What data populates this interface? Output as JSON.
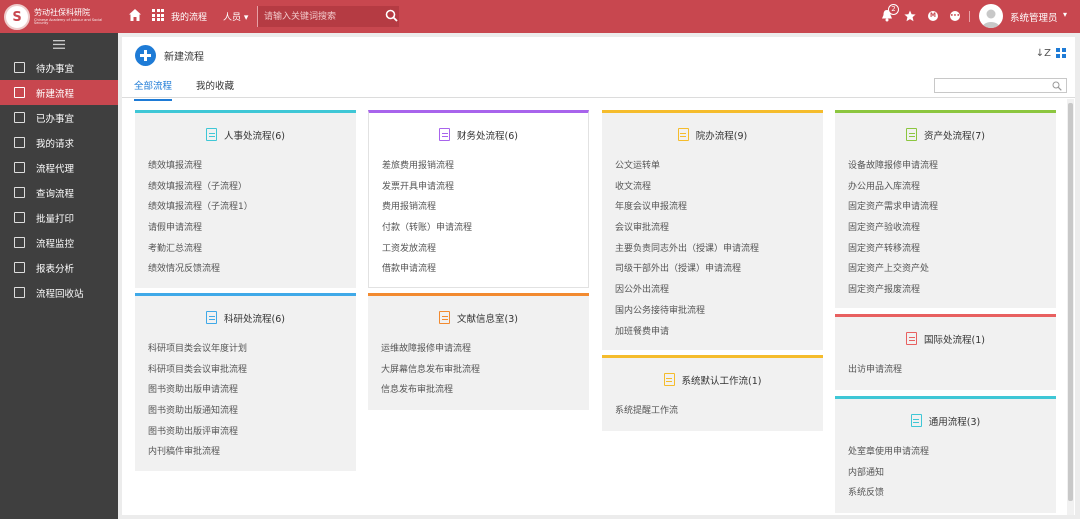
{
  "header": {
    "logo_cn": "劳动社保科研院",
    "logo_en": "Chinese Academy of Labour and Social Security",
    "logo_mark": "S",
    "nav_flow": "我的流程",
    "search_category": "人员",
    "search_placeholder": "请输入关键词搜索",
    "notification_count": "2",
    "round_icon_m": "M",
    "round_icon_more": "•••",
    "user_name": "系统管理员",
    "accent_color": "#c8474f"
  },
  "sidebar": {
    "items": [
      {
        "label": "待办事宜",
        "icon": "todo-icon"
      },
      {
        "label": "新建流程",
        "icon": "new-flow-icon",
        "active": true
      },
      {
        "label": "已办事宜",
        "icon": "done-icon"
      },
      {
        "label": "我的请求",
        "icon": "request-icon"
      },
      {
        "label": "流程代理",
        "icon": "agent-icon"
      },
      {
        "label": "查询流程",
        "icon": "search-icon"
      },
      {
        "label": "批量打印",
        "icon": "print-icon"
      },
      {
        "label": "流程监控",
        "icon": "monitor-icon"
      },
      {
        "label": "报表分析",
        "icon": "report-icon"
      },
      {
        "label": "流程回收站",
        "icon": "recycle-icon"
      }
    ]
  },
  "main": {
    "title": "新建流程",
    "sort_label": "↓Z",
    "tabs": [
      {
        "label": "全部流程",
        "active": true
      },
      {
        "label": "我的收藏"
      }
    ],
    "filter_placeholder": ""
  },
  "cards": [
    {
      "name": "card-hr",
      "title": "人事处流程(6)",
      "color": "#3fc7d6",
      "items": [
        "绩效填报流程",
        "绩效填报流程（子流程）",
        "绩效填报流程（子流程1）",
        "请假申请流程",
        "考勤汇总流程",
        "绩效情况反馈流程"
      ]
    },
    {
      "name": "card-research",
      "title": "科研处流程(6)",
      "color": "#3fa9e8",
      "items": [
        "科研项目类会议年度计划",
        "科研项目类会议审批流程",
        "图书资助出版申请流程",
        "图书资助出版通知流程",
        "图书资助出版评审流程",
        "内刊稿件审批流程"
      ]
    },
    {
      "name": "card-finance",
      "title": "财务处流程(6)",
      "color": "#a864ec",
      "items": [
        "差旅费用报销流程",
        "发票开具申请流程",
        "费用报销流程",
        "付款（转账）申请流程",
        "工资发放流程",
        "借款申请流程"
      ]
    },
    {
      "name": "card-literature",
      "title": "文献信息室(3)",
      "color": "#f28a30",
      "items": [
        "运维故障报修申请流程",
        "大屏幕信息发布审批流程",
        "信息发布审批流程"
      ]
    },
    {
      "name": "card-office",
      "title": "院办流程(9)",
      "color": "#f5bc2c",
      "items": [
        "公文运转单",
        "收文流程",
        "年度会议申报流程",
        "会议审批流程",
        "主要负责同志外出（授课）申请流程",
        "司级干部外出（授课）申请流程",
        "因公外出流程",
        "国内公务接待审批流程",
        "加班餐费申请"
      ]
    },
    {
      "name": "card-default",
      "title": "系统默认工作流(1)",
      "color": "#f5bc2c",
      "items": [
        "系统提醒工作流"
      ]
    },
    {
      "name": "card-assets",
      "title": "资产处流程(7)",
      "color": "#8cc63f",
      "items": [
        "设备故障报修申请流程",
        "办公用品入库流程",
        "固定资产需求申请流程",
        "固定资产验收流程",
        "固定资产转移流程",
        "固定资产上交资产处",
        "固定资产报废流程"
      ]
    },
    {
      "name": "card-intl",
      "title": "国际处流程(1)",
      "color": "#e86060",
      "items": [
        "出访申请流程"
      ]
    },
    {
      "name": "card-general",
      "title": "通用流程(3)",
      "color": "#3fc7d6",
      "items": [
        "处室章使用申请流程",
        "内部通知",
        "系统反馈"
      ]
    }
  ]
}
